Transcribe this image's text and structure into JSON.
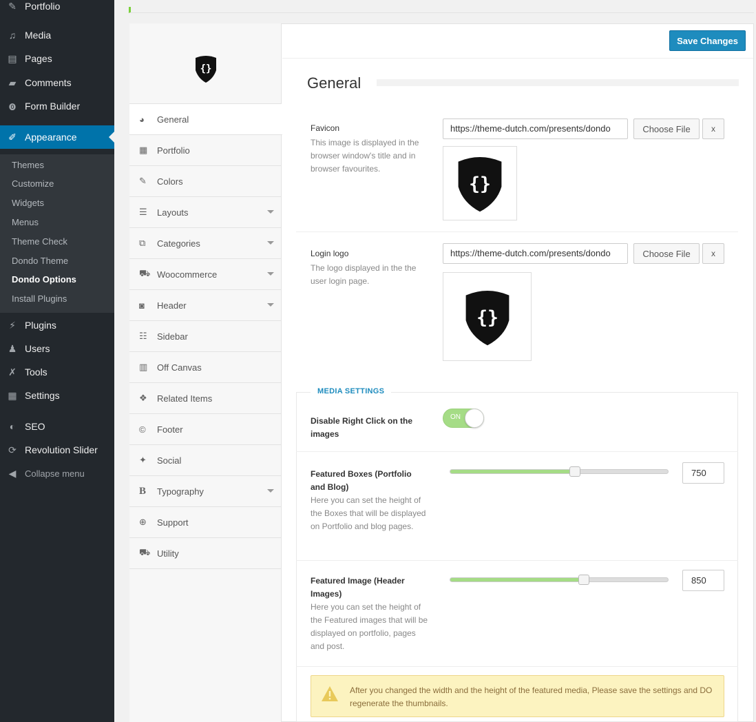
{
  "wp_menu": {
    "items": [
      {
        "label": "Portfolio",
        "icon": "pin-icon"
      },
      {
        "label": "Media",
        "icon": "media-icon"
      },
      {
        "label": "Pages",
        "icon": "pages-icon"
      },
      {
        "label": "Comments",
        "icon": "comments-icon"
      },
      {
        "label": "Form Builder",
        "icon": "form-builder-icon"
      },
      {
        "label": "Appearance",
        "icon": "appearance-icon"
      },
      {
        "label": "Plugins",
        "icon": "plugins-icon"
      },
      {
        "label": "Users",
        "icon": "users-icon"
      },
      {
        "label": "Tools",
        "icon": "tools-icon"
      },
      {
        "label": "Settings",
        "icon": "settings-icon"
      },
      {
        "label": "SEO",
        "icon": "seo-icon"
      },
      {
        "label": "Revolution Slider",
        "icon": "refresh-icon"
      },
      {
        "label": "Collapse menu",
        "icon": "collapse-icon"
      }
    ],
    "submenu": [
      "Themes",
      "Customize",
      "Widgets",
      "Menus",
      "Theme Check",
      "Dondo Theme",
      "Dondo Options",
      "Install Plugins"
    ],
    "current_submenu": "Dondo Options"
  },
  "options_nav": {
    "items": [
      {
        "label": "General",
        "icon": "dashboard-icon",
        "has_caret": false,
        "active": true
      },
      {
        "label": "Portfolio",
        "icon": "grid-icon",
        "has_caret": false
      },
      {
        "label": "Colors",
        "icon": "brush-icon",
        "has_caret": false
      },
      {
        "label": "Layouts",
        "icon": "layouts-icon",
        "has_caret": true
      },
      {
        "label": "Categories",
        "icon": "sitemap-icon",
        "has_caret": true
      },
      {
        "label": "Woocommerce",
        "icon": "cart-icon",
        "has_caret": true
      },
      {
        "label": "Header",
        "icon": "camera-icon",
        "has_caret": true
      },
      {
        "label": "Sidebar",
        "icon": "list-icon",
        "has_caret": false
      },
      {
        "label": "Off Canvas",
        "icon": "off-canvas-icon",
        "has_caret": false
      },
      {
        "label": "Related Items",
        "icon": "cubes-icon",
        "has_caret": false
      },
      {
        "label": "Footer",
        "icon": "copyright-icon",
        "has_caret": false
      },
      {
        "label": "Social",
        "icon": "twitter-icon",
        "has_caret": false
      },
      {
        "label": "Typography",
        "icon": "bold-icon",
        "has_caret": true
      },
      {
        "label": "Support",
        "icon": "lifebuoy-icon",
        "has_caret": false
      },
      {
        "label": "Utility",
        "icon": "truck-icon",
        "has_caret": false
      }
    ]
  },
  "header": {
    "save_label": "Save Changes",
    "title": "General"
  },
  "favicon": {
    "label": "Favicon",
    "description": "This image is displayed in the browser window's title and in browser favourites.",
    "url": "https://theme-dutch.com/presents/dondo",
    "choose_label": "Choose File",
    "clear_label": "x"
  },
  "login_logo": {
    "label": "Login logo",
    "description": "The logo displayed in the the user login page.",
    "url": "https://theme-dutch.com/presents/dondo",
    "choose_label": "Choose File",
    "clear_label": "x"
  },
  "media_settings": {
    "legend": "MEDIA SETTINGS",
    "disable_right_click": {
      "label": "Disable Right Click on the images",
      "toggle_text": "ON",
      "value": true
    },
    "featured_boxes": {
      "label": "Featured Boxes (Portfolio and Blog)",
      "description": "Here you can set the height of the Boxes that will be displayed on Portfolio and blog pages.",
      "value": "750",
      "slider_fraction": 0.57
    },
    "featured_image": {
      "label": "Featured Image (Header Images)",
      "description": "Here you can set the height of the Featured images that will be displayed on portfolio, pages and post.",
      "value": "850",
      "slider_fraction": 0.61
    },
    "warning": "After you changed the width and the height of the featured media, Please save the settings and DO regenerate the thumbnails."
  },
  "colors": {
    "accent": "#1e8cbe",
    "toggle_on": "#a5dc86",
    "wp_active": "#0073aa"
  }
}
